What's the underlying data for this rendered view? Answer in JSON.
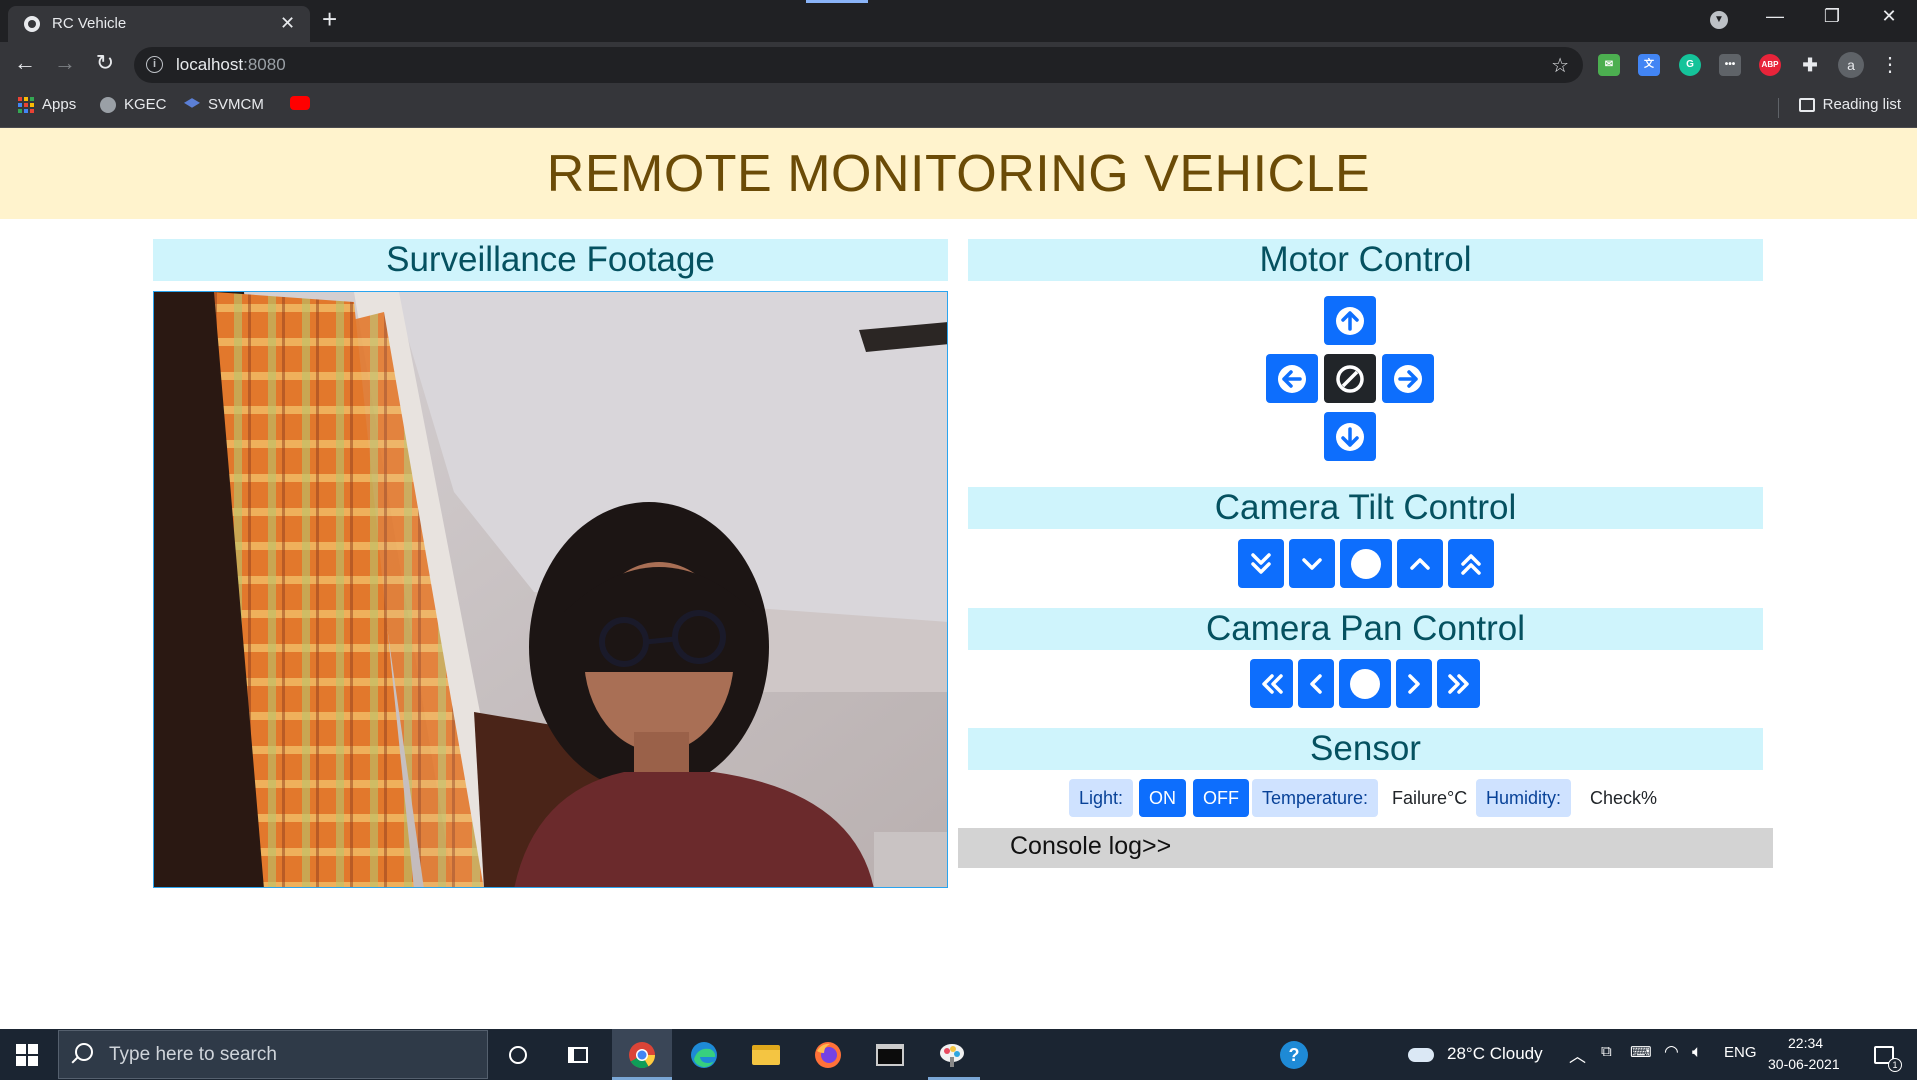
{
  "browser": {
    "tab_title": "RC Vehicle",
    "tab_close": "✕",
    "new_tab": "+",
    "window_controls": {
      "minimize": "—",
      "restore": "❐",
      "close": "✕"
    },
    "url_host": "localhost",
    "url_port": ":8080",
    "nav": {
      "back": "←",
      "forward": "→",
      "reload": "↻"
    },
    "star": "☆",
    "extensions": [
      "ABP"
    ],
    "profile_initial": "a",
    "menu": "⋮",
    "bookmarks": [
      {
        "label": "Apps",
        "icon": "apps-grid-icon"
      },
      {
        "label": "KGEC",
        "icon": "globe-icon"
      },
      {
        "label": "SVMCM",
        "icon": "graduation-cap-icon"
      },
      {
        "label": "",
        "icon": "youtube-icon"
      }
    ],
    "reading_list": "Reading list"
  },
  "page": {
    "banner_title": "REMOTE MONITORING VEHICLE",
    "surveillance_heading": "Surveillance Footage",
    "motor_heading": "Motor Control",
    "tilt_heading": "Camera Tilt Control",
    "pan_heading": "Camera Pan Control",
    "sensor_heading": "Sensor",
    "sensor": {
      "light_label": "Light:",
      "on_label": "ON",
      "off_label": "OFF",
      "temperature_label": "Temperature:",
      "temperature_value": "Failure°C",
      "humidity_label": "Humidity:",
      "humidity_value": "Check%"
    },
    "console_label": "Console log>>",
    "colors": {
      "banner_bg": "#fff3cd",
      "banner_text": "#6b4b07",
      "heading_bg": "#cff4fc",
      "heading_text": "#055160",
      "primary": "#0d6efd",
      "dark": "#212529",
      "badge_info_bg": "#cfe2ff",
      "console_bg": "#d3d3d3"
    }
  },
  "taskbar": {
    "search_placeholder": "Type here to search",
    "weather": "28°C  Cloudy",
    "language": "ENG",
    "time": "22:34",
    "date": "30-06-2021",
    "notification_count": "1"
  }
}
